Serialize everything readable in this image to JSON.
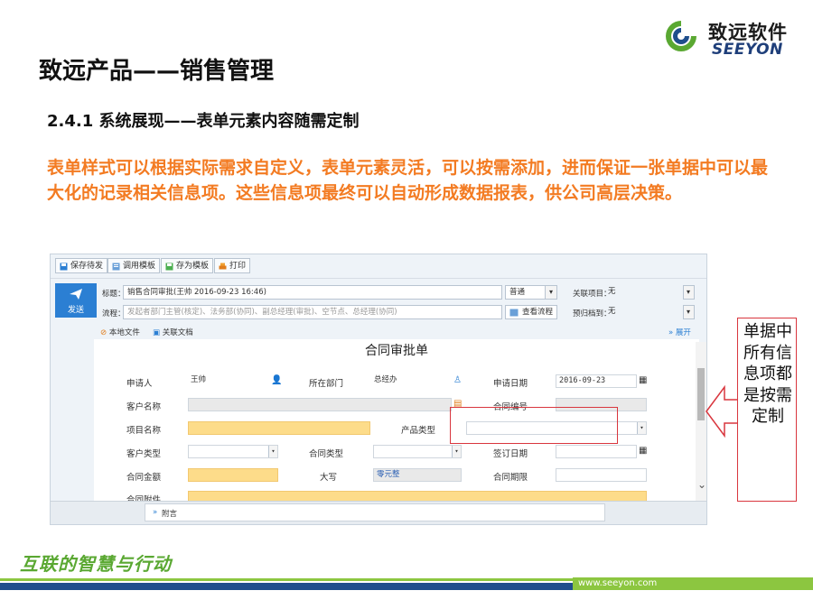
{
  "brand": {
    "name_cn": "致远软件",
    "name_en": "SEEYON",
    "logo_icon": "seeyon-swirl-logo"
  },
  "slide": {
    "title": "致远产品——销售管理",
    "section": "2.4.1 系统展现——表单元素内容随需定制",
    "description": "表单样式可以根据实际需求自定义，表单元素灵活，可以按需添加，进而保证一张单据中可以最大化的记录相关信息项。这些信息项最终可以自动形成数据报表，供公司高层决策。"
  },
  "app": {
    "toolbar": {
      "save_draft": "保存待发",
      "call_template": "调用模板",
      "save_as_template": "存为模板",
      "print": "打印"
    },
    "send_label": "发送",
    "subject_label": "标题：",
    "subject_value": "销售合同审批(王帅 2016-09-23 16:46)",
    "priority_value": "普通",
    "related_project_label": "关联项目：",
    "related_project_value": "无",
    "workflow_label": "流程：",
    "workflow_value": "发起者部门主管(核定)、法务部(协同)、副总经理(审批)、空节点、总经理(协同)",
    "view_workflow": "查看流程",
    "archive_label": "预归档到：",
    "archive_value": "无",
    "local_file": "本地文件",
    "related_doc": "关联文档",
    "expand": "展开",
    "attachment_tab": "附言"
  },
  "form": {
    "title": "合同审批单",
    "applicant_label": "申请人",
    "applicant_value": "王帅",
    "dept_label": "所在部门",
    "dept_value": "总经办",
    "apply_date_label": "申请日期",
    "apply_date_value": "2016-09-23",
    "customer_name_label": "客户名称",
    "contract_no_label": "合同编号",
    "project_name_label": "项目名称",
    "product_type_label": "产品类型",
    "customer_type_label": "客户类型",
    "contract_type_label": "合同类型",
    "sign_date_label": "签订日期",
    "amount_label": "合同金额",
    "uppercase_label": "大写",
    "uppercase_value": "零元整",
    "period_label": "合同期限",
    "attachment_label": "合同附件"
  },
  "callout": {
    "text": "单据中所有信息项都是按需定制"
  },
  "footer": {
    "slogan": "互联的智慧与行动",
    "url": "www.seeyon.com"
  },
  "colors": {
    "accent_orange": "#f37b22",
    "highlight_red": "#d9363e",
    "send_blue": "#2b7fd3",
    "required_yellow": "#fddc8a",
    "footer_green": "#8cc640",
    "footer_navy": "#1f4e8c"
  }
}
